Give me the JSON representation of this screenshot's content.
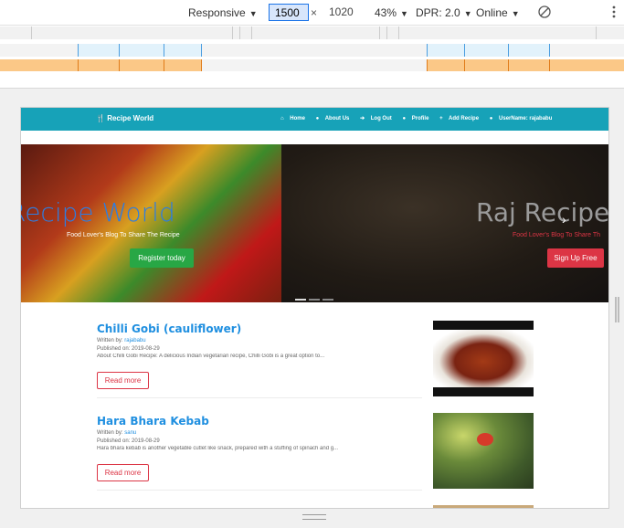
{
  "devtools": {
    "device": "Responsive",
    "width_value": "1500",
    "height_value": "1020",
    "times_sign": "×",
    "zoom": "43%",
    "dpr": "DPR: 2.0",
    "network": "Online",
    "caret": "▼",
    "colors": {
      "blue_tick": "#4a9de0",
      "blue_fill": "#e2f2fb",
      "orange_fill": "#fbc887",
      "orange_tick": "#e07c1a"
    }
  },
  "page": {
    "brand": "Recipe World",
    "nav": [
      "Home",
      "About Us",
      "Log Out",
      "Profile",
      "Add Recipe",
      "UserName: rajababu"
    ],
    "carousel": {
      "slide1": {
        "title": "Recipe World",
        "subtitle": "Food Lover's Blog To Share The Recipe",
        "button": "Register today"
      },
      "slide2": {
        "title": "Raj Recipe W",
        "subtitle": "Food Lover's Blog To Share Th",
        "button": "Sign Up Free"
      },
      "next_icon": "chevron-right-icon"
    },
    "posts": [
      {
        "title": "Chilli Gobi (cauliflower)",
        "written_label": "Written by:",
        "author": "rajababu",
        "published": "Published on: 2019-08-29",
        "desc": "About Chilli Gobi Recipe: A delicious Indian vegetarian recipe, Chilli Gobi is a great option to...",
        "button": "Read more"
      },
      {
        "title": "Hara Bhara Kebab",
        "written_label": "Written by:",
        "author": "sanu",
        "published": "Published on: 2019-08-29",
        "desc": "Hara bhara kebab is another vegetable cutlet like snack, prepared with a stuffing of spinach and g...",
        "button": "Read more"
      }
    ],
    "colors": {
      "navbar": "#17a2b8",
      "link": "#1f8fe0",
      "danger": "#dc3545",
      "success": "#28a745"
    }
  }
}
